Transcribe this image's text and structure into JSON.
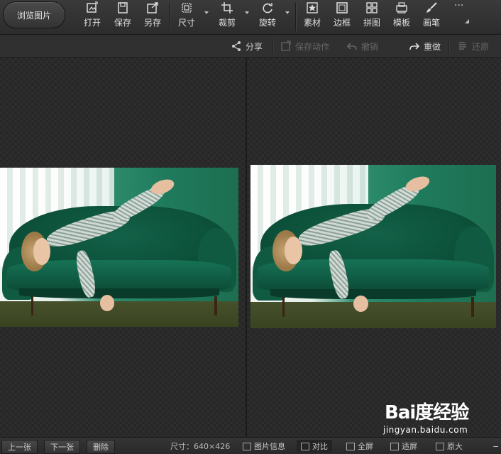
{
  "toolbar": {
    "browse_label": "浏览图片",
    "items": [
      {
        "label": "打开",
        "icon": "open-icon"
      },
      {
        "label": "保存",
        "icon": "save-icon"
      },
      {
        "label": "另存",
        "icon": "save-as-icon"
      },
      {
        "label": "尺寸",
        "icon": "resize-icon"
      },
      {
        "label": "裁剪",
        "icon": "crop-icon"
      },
      {
        "label": "旋转",
        "icon": "rotate-icon"
      },
      {
        "label": "素材",
        "icon": "sticker-icon"
      },
      {
        "label": "边框",
        "icon": "frame-icon"
      },
      {
        "label": "拼图",
        "icon": "collage-icon"
      },
      {
        "label": "模板",
        "icon": "template-icon"
      },
      {
        "label": "画笔",
        "icon": "brush-icon"
      }
    ],
    "more_label": "···"
  },
  "actions": {
    "share": "分享",
    "save_action": "保存动作",
    "undo": "撤销",
    "redo": "重做",
    "restore": "还原"
  },
  "statusbar": {
    "prev": "上一张",
    "next": "下一张",
    "delete": "删除",
    "size_text": "尺寸：640×426",
    "image_info": "图片信息",
    "compare": "对比",
    "fullscreen": "全屏",
    "fit": "适屏",
    "original": "原大",
    "zoom_out": "−"
  },
  "watermark": {
    "logo": "Bai度经验",
    "url": "jingyan.baidu.com"
  },
  "colors": {
    "background": "#2a2a2a",
    "toolbar": "#333333",
    "text": "#e0e0e0",
    "disabled": "#666666"
  }
}
